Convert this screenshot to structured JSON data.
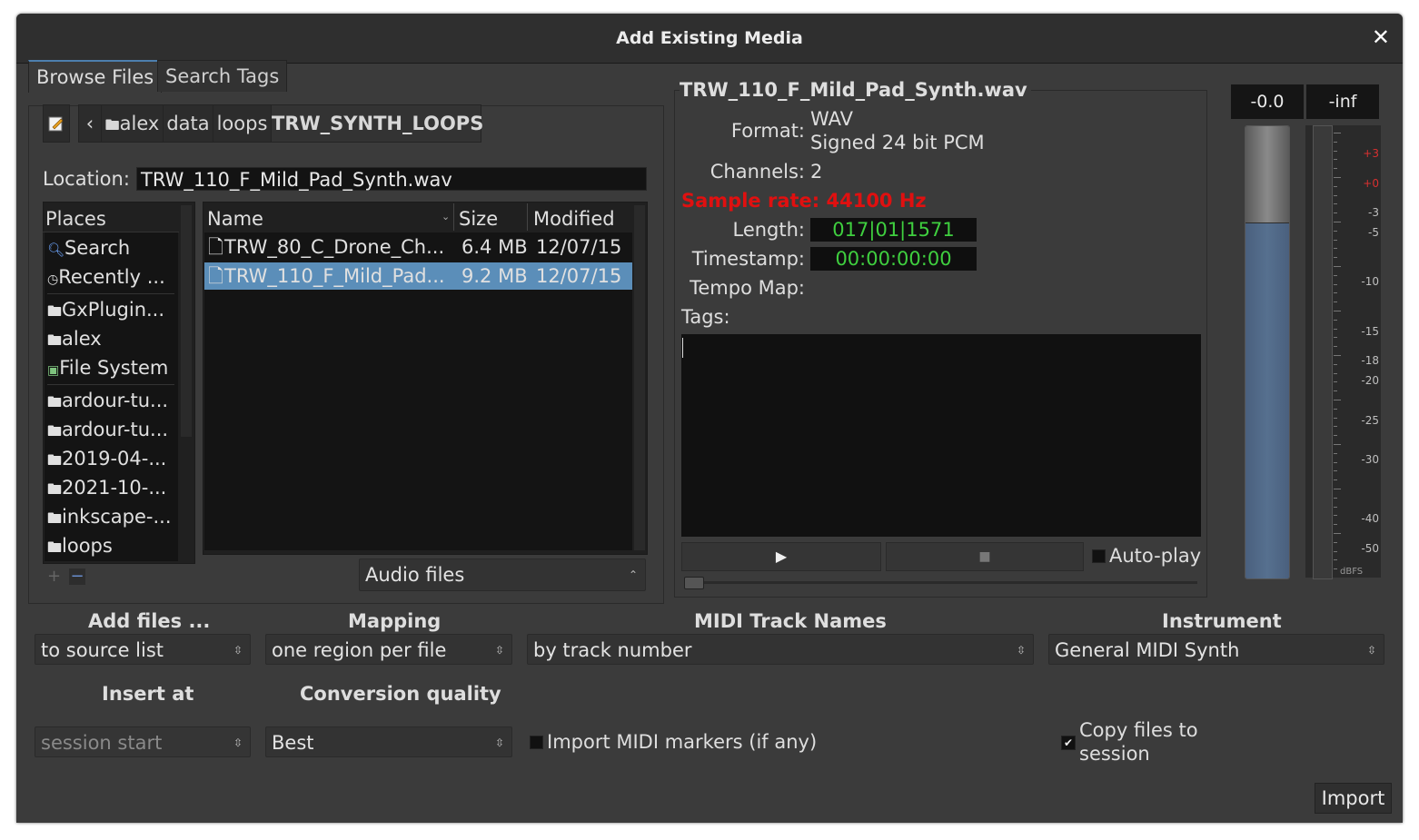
{
  "window": {
    "title": "Add Existing Media",
    "close_icon": "close-icon"
  },
  "tabs": [
    {
      "label": "Browse Files",
      "active": true
    },
    {
      "label": "Search Tags",
      "active": false
    }
  ],
  "path_bar": {
    "crumbs": [
      "alex",
      "data",
      "loops",
      "TRW_SYNTH_LOOPS"
    ]
  },
  "location": {
    "label": "Location:",
    "value": "TRW_110_F_Mild_Pad_Synth.wav"
  },
  "places": {
    "header": "Places",
    "items": [
      "Search",
      "Recently ...",
      "GxPlugin...",
      "alex",
      "File System",
      "ardour-tu...",
      "ardour-tu...",
      "2019-04-...",
      "2021-10-...",
      "inkscape-...",
      "loops"
    ]
  },
  "files": {
    "columns": [
      "Name",
      "Size",
      "Modified"
    ],
    "rows": [
      {
        "name": "TRW_80_C_Drone_Ch...",
        "size": "6.4 MB",
        "modified": "12/07/15",
        "selected": false
      },
      {
        "name": "TRW_110_F_Mild_Pad...",
        "size": "9.2 MB",
        "modified": "12/07/15",
        "selected": true
      }
    ],
    "filter": "Audio files"
  },
  "preview": {
    "filename": "TRW_110_F_Mild_Pad_Synth.wav",
    "format_label": "Format:",
    "format_value1": "WAV",
    "format_value2": "Signed 24 bit PCM",
    "channels_label": "Channels:",
    "channels_value": "2",
    "sample_rate": "Sample rate: 44100 Hz",
    "length_label": "Length:",
    "length_value": "017|01|1571",
    "timestamp_label": "Timestamp:",
    "timestamp_value": "00:00:00:00",
    "tempo_label": "Tempo Map:",
    "tags_label": "Tags:",
    "autoplay_label": "Auto-play"
  },
  "meters": {
    "peak_left": "-0.0",
    "peak_right": "-inf",
    "scale": [
      "+3",
      "+0",
      "-3",
      "-5",
      "-10",
      "-15",
      "-18",
      "-20",
      "-25",
      "-30",
      "-40",
      "-50",
      "dBFS"
    ]
  },
  "options": {
    "add_files_label": "Add files ...",
    "add_files_value": "to source list",
    "mapping_label": "Mapping",
    "mapping_value": "one region per file",
    "midi_names_label": "MIDI Track Names",
    "midi_names_value": "by track number",
    "instrument_label": "Instrument",
    "instrument_value": "General MIDI Synth",
    "insert_at_label": "Insert at",
    "insert_at_value": "session start",
    "quality_label": "Conversion quality",
    "quality_value": "Best",
    "import_midi_markers": "Import MIDI markers (if any)",
    "copy_files_line1": "Copy files to",
    "copy_files_line2": "session"
  },
  "import_button": "Import",
  "colors": {
    "accent": "#4d7fae",
    "selected_row": "#5b8eb9",
    "sample_rate_red": "#e01010",
    "clock_green": "#3fcf3f"
  }
}
